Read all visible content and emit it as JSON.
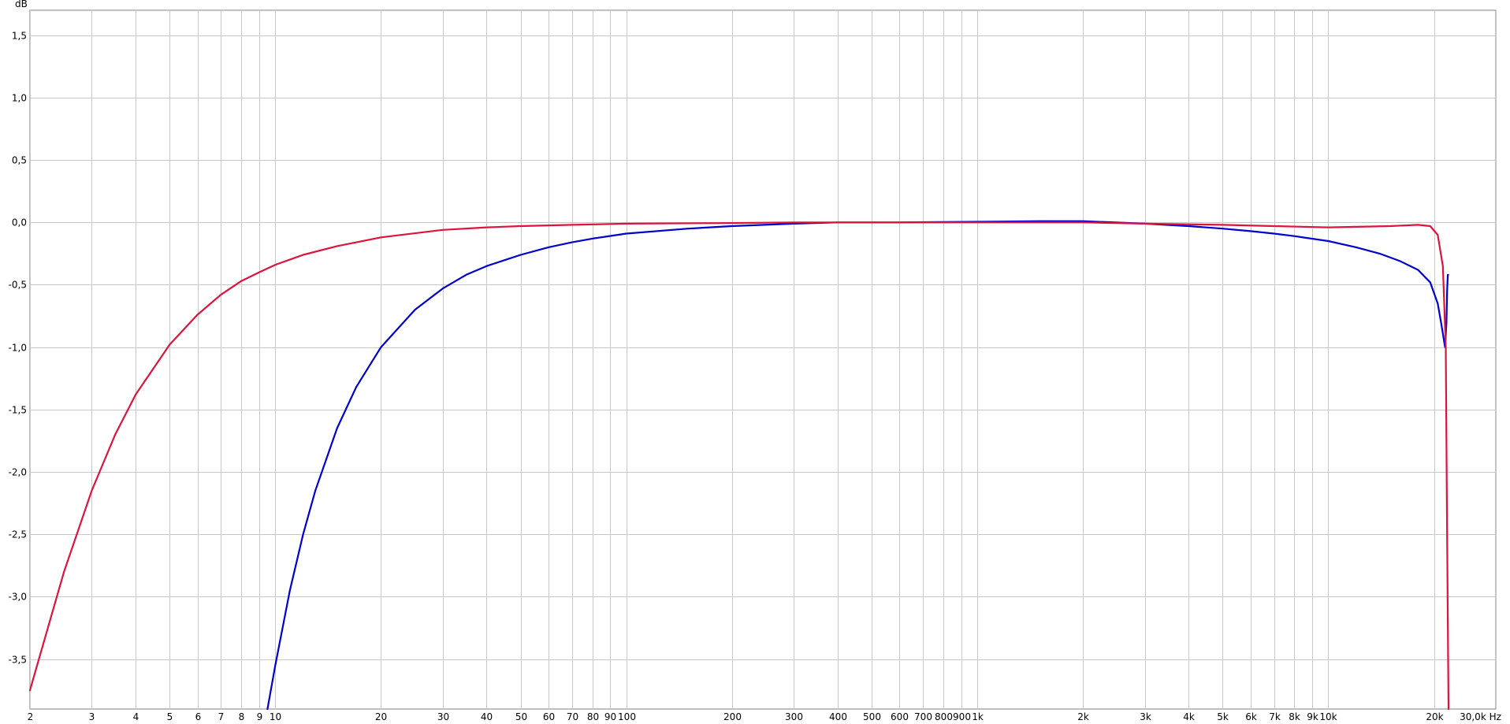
{
  "chart_data": {
    "type": "line",
    "title": "",
    "xlabel": "",
    "ylabel": "",
    "y_unit": "dB",
    "x_unit": "Hz",
    "x_scale": "log",
    "xlim": [
      2,
      30000
    ],
    "ylim": [
      -3.9,
      1.7
    ],
    "grid": true,
    "legend": "none",
    "x_ticks": [
      {
        "value": 2,
        "label": "2"
      },
      {
        "value": 3,
        "label": "3"
      },
      {
        "value": 4,
        "label": "4"
      },
      {
        "value": 5,
        "label": "5"
      },
      {
        "value": 6,
        "label": "6"
      },
      {
        "value": 7,
        "label": "7"
      },
      {
        "value": 8,
        "label": "8"
      },
      {
        "value": 9,
        "label": "9"
      },
      {
        "value": 10,
        "label": "10"
      },
      {
        "value": 20,
        "label": "20"
      },
      {
        "value": 30,
        "label": "30"
      },
      {
        "value": 40,
        "label": "40"
      },
      {
        "value": 50,
        "label": "50"
      },
      {
        "value": 60,
        "label": "60"
      },
      {
        "value": 70,
        "label": "70"
      },
      {
        "value": 80,
        "label": "80"
      },
      {
        "value": 90,
        "label": "90"
      },
      {
        "value": 100,
        "label": "100"
      },
      {
        "value": 200,
        "label": "200"
      },
      {
        "value": 300,
        "label": "300"
      },
      {
        "value": 400,
        "label": "400"
      },
      {
        "value": 500,
        "label": "500"
      },
      {
        "value": 600,
        "label": "600"
      },
      {
        "value": 700,
        "label": "700"
      },
      {
        "value": 800,
        "label": "800"
      },
      {
        "value": 900,
        "label": "900"
      },
      {
        "value": 1000,
        "label": "1k"
      },
      {
        "value": 2000,
        "label": "2k"
      },
      {
        "value": 3000,
        "label": "3k"
      },
      {
        "value": 4000,
        "label": "4k"
      },
      {
        "value": 5000,
        "label": "5k"
      },
      {
        "value": 6000,
        "label": "6k"
      },
      {
        "value": 7000,
        "label": "7k"
      },
      {
        "value": 8000,
        "label": "8k"
      },
      {
        "value": 9000,
        "label": "9k"
      },
      {
        "value": 10000,
        "label": "10k"
      },
      {
        "value": 20000,
        "label": "20k"
      },
      {
        "value": 30000,
        "label": "30,0k Hz"
      }
    ],
    "y_ticks": [
      {
        "value": 1.5,
        "label": "1,5"
      },
      {
        "value": 1.0,
        "label": "1,0"
      },
      {
        "value": 0.5,
        "label": "0,5"
      },
      {
        "value": 0.0,
        "label": "0,0"
      },
      {
        "value": -0.5,
        "label": "-0,5"
      },
      {
        "value": -1.0,
        "label": "-1,0"
      },
      {
        "value": -1.5,
        "label": "-1,5"
      },
      {
        "value": -2.0,
        "label": "-2,0"
      },
      {
        "value": -2.5,
        "label": "-2,5"
      },
      {
        "value": -3.0,
        "label": "-3,0"
      },
      {
        "value": -3.5,
        "label": "-3,5"
      }
    ],
    "series": [
      {
        "color": "#dc143c",
        "x": [
          2,
          2.5,
          3,
          3.5,
          4,
          5,
          6,
          7,
          8,
          9,
          10,
          12,
          15,
          20,
          30,
          40,
          50,
          70,
          100,
          200,
          300,
          500,
          1000,
          2000,
          3000,
          5000,
          7000,
          10000,
          15000,
          18000,
          19500,
          20500,
          21200,
          21600,
          21800,
          22000
        ],
        "y": [
          -3.75,
          -2.8,
          -2.15,
          -1.7,
          -1.38,
          -0.98,
          -0.74,
          -0.58,
          -0.47,
          -0.4,
          -0.34,
          -0.26,
          -0.19,
          -0.12,
          -0.06,
          -0.04,
          -0.03,
          -0.02,
          -0.01,
          -0.005,
          0,
          0,
          0,
          0,
          -0.01,
          -0.02,
          -0.03,
          -0.04,
          -0.03,
          -0.02,
          -0.03,
          -0.1,
          -0.35,
          -1.0,
          -2.5,
          -3.9
        ]
      },
      {
        "color": "#0000cd",
        "x": [
          9.5,
          10,
          11,
          12,
          13,
          15,
          17,
          20,
          25,
          30,
          35,
          40,
          50,
          60,
          70,
          80,
          100,
          150,
          200,
          300,
          400,
          600,
          1000,
          1500,
          2000,
          3000,
          4000,
          5000,
          6000,
          7000,
          8000,
          10000,
          12000,
          14000,
          16000,
          18000,
          19500,
          20500,
          21000,
          21500,
          21700,
          21800,
          21900,
          21950
        ],
        "y": [
          -3.9,
          -3.55,
          -2.95,
          -2.5,
          -2.15,
          -1.65,
          -1.32,
          -1.0,
          -0.7,
          -0.53,
          -0.42,
          -0.35,
          -0.26,
          -0.2,
          -0.16,
          -0.13,
          -0.09,
          -0.05,
          -0.03,
          -0.01,
          0,
          0,
          0.005,
          0.01,
          0.01,
          -0.01,
          -0.03,
          -0.05,
          -0.07,
          -0.09,
          -0.11,
          -0.15,
          -0.2,
          -0.25,
          -0.31,
          -0.38,
          -0.48,
          -0.65,
          -0.82,
          -1.0,
          -0.8,
          -0.55,
          -0.42,
          -0.42
        ]
      }
    ]
  }
}
